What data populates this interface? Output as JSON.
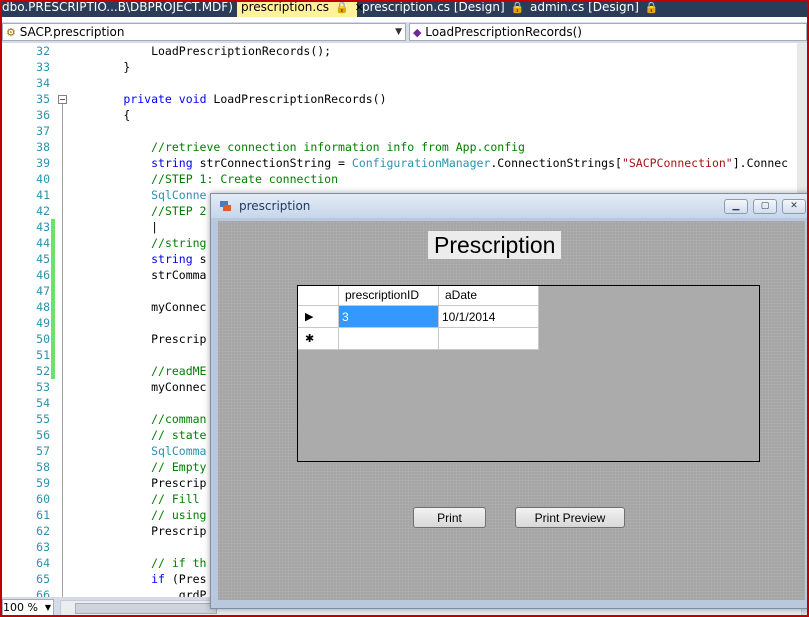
{
  "tabs": [
    {
      "label": "dbo.PRESCRIPTIO...B\\DBPROJECT.MDF)"
    },
    {
      "label": "prescription.cs",
      "active": true,
      "close": "✕",
      "pin": "🔒"
    },
    {
      "label": "prescription.cs [Design]",
      "pin": "🔒"
    },
    {
      "label": "admin.cs [Design]",
      "pin": "🔒"
    }
  ],
  "memberbar": {
    "class_combo": "SACP.prescription",
    "member_combo": "LoadPrescriptionRecords()"
  },
  "editor": {
    "lines": [
      {
        "n": "32",
        "html": "            LoadPrescriptionRecords();"
      },
      {
        "n": "33",
        "html": "        }"
      },
      {
        "n": "34",
        "html": ""
      },
      {
        "n": "35",
        "html": "        <span class='kw'>private</span> <span class='kw'>void</span> LoadPrescriptionRecords()"
      },
      {
        "n": "36",
        "html": "        {"
      },
      {
        "n": "37",
        "html": ""
      },
      {
        "n": "38",
        "html": "            <span class='cm'>//retrieve connection information info from App.config</span>"
      },
      {
        "n": "39",
        "html": "            <span class='kw'>string</span> strConnectionString = <span class='ty'>ConfigurationManager</span>.ConnectionStrings[<span class='st'>\"SACPConnection\"</span>].Connec"
      },
      {
        "n": "40",
        "html": "            <span class='cm'>//STEP 1: Create connection</span>"
      },
      {
        "n": "41",
        "html": "            <span class='ty'>SqlConne</span>"
      },
      {
        "n": "42",
        "html": "            <span class='cm'>//STEP 2</span>"
      },
      {
        "n": "43",
        "html": "            |"
      },
      {
        "n": "44",
        "html": "            <span class='cm'>//string</span>"
      },
      {
        "n": "45",
        "html": "            <span class='kw'>string</span> s"
      },
      {
        "n": "46",
        "html": "            strComma"
      },
      {
        "n": "47",
        "html": ""
      },
      {
        "n": "48",
        "html": "            myConnec"
      },
      {
        "n": "49",
        "html": ""
      },
      {
        "n": "50",
        "html": "            Prescrip"
      },
      {
        "n": "51",
        "html": ""
      },
      {
        "n": "52",
        "html": "            <span class='cm'>//readME</span>"
      },
      {
        "n": "53",
        "html": "            myConnec"
      },
      {
        "n": "54",
        "html": ""
      },
      {
        "n": "55",
        "html": "            <span class='cm'>//comman</span>"
      },
      {
        "n": "56",
        "html": "            <span class='cm'>// state</span>"
      },
      {
        "n": "57",
        "html": "            <span class='ty'>SqlComma</span>"
      },
      {
        "n": "58",
        "html": "            <span class='cm'>// Empty</span>"
      },
      {
        "n": "59",
        "html": "            Prescrip"
      },
      {
        "n": "60",
        "html": "            <span class='cm'>// Fill</span>"
      },
      {
        "n": "61",
        "html": "            <span class='cm'>// using</span>"
      },
      {
        "n": "62",
        "html": "            Prescrip"
      },
      {
        "n": "63",
        "html": ""
      },
      {
        "n": "64",
        "html": "            <span class='cm'>// if th</span>"
      },
      {
        "n": "65",
        "html": "            <span class='kw'>if</span> (Pres"
      },
      {
        "n": "66",
        "html": "                grdP"
      }
    ]
  },
  "status": {
    "zoom": "100 %"
  },
  "form": {
    "window_title": "prescription",
    "heading": "Prescription",
    "grid": {
      "columns": [
        "prescriptionID",
        "aDate"
      ],
      "rows": [
        [
          "3",
          "10/1/2014"
        ],
        [
          "",
          ""
        ]
      ],
      "row_markers": [
        "▶",
        "✱"
      ]
    },
    "buttons": {
      "print": "Print",
      "print_preview": "Print Preview"
    }
  }
}
